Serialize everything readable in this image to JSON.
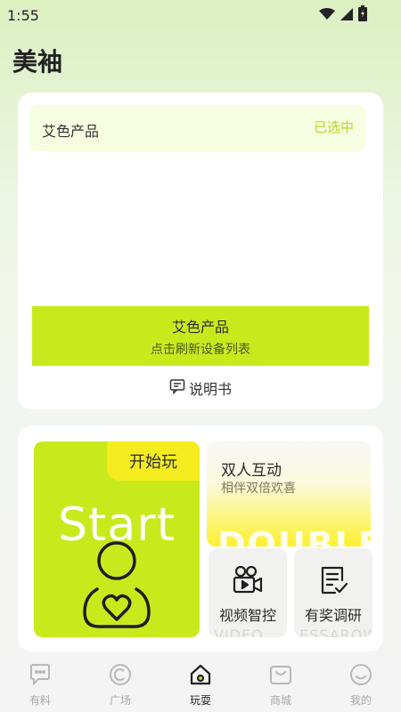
{
  "status_bar": {
    "time": "1:55"
  },
  "app": {
    "title": "美袖"
  },
  "device_card": {
    "product_name": "艾色产品",
    "product_status": "已选中",
    "refresh_button": {
      "title": "艾色产品",
      "subtitle": "点击刷新设备列表"
    },
    "manual_link": "说明书"
  },
  "play_card": {
    "start": {
      "tab_label": "开始玩",
      "word": "Start"
    },
    "double": {
      "title": "双人互动",
      "subtitle": "相伴双倍欢喜",
      "word": "DOUBLE"
    },
    "video": {
      "label": "视频智控",
      "ghost": "VIDEO"
    },
    "survey": {
      "label": "有奖调研",
      "ghost": "ESSAROW"
    }
  },
  "bottom_nav": {
    "items": [
      {
        "label": "有料",
        "icon": "chat-bubble-icon"
      },
      {
        "label": "广场",
        "icon": "copyright-circle-icon"
      },
      {
        "label": "玩耍",
        "icon": "home-icon"
      },
      {
        "label": "商城",
        "icon": "shop-icon"
      },
      {
        "label": "我的",
        "icon": "smile-icon"
      }
    ],
    "active_index": 2
  },
  "colors": {
    "accent": "#c8ea1c",
    "accent_yellow": "#f4ec1e",
    "selected_text": "#b9d81f"
  }
}
